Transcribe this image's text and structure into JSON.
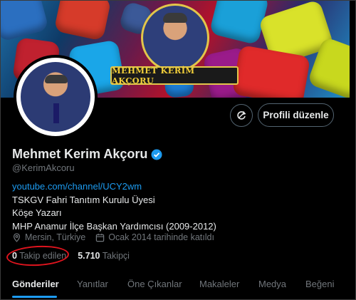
{
  "banner": {
    "overlay_name": "MEHMET KERİM AKÇORU"
  },
  "profile": {
    "display_name": "Mehmet Kerim Akçoru",
    "handle": "@KerimAkcoru",
    "verified_icon": "verified-badge-icon",
    "link": "youtube.com/channel/UCY2wm",
    "bio_lines": [
      "TSKGV Fahri Tanıtım Kurulu Üyesi",
      "Köşe Yazarı",
      "MHP Anamur İlçe Başkan Yardımcısı (2009-2012)"
    ],
    "location": "Mersin, Türkiye",
    "joined": "Ocak 2014 tarihinde katıldı"
  },
  "actions": {
    "edit_profile": "Profili düzenle",
    "refresh_icon": "refresh-icon"
  },
  "stats": {
    "following_count": "0",
    "following_label": "Takip edilen",
    "followers_count": "5.710",
    "followers_label": "Takipçi"
  },
  "tabs": [
    {
      "label": "Gönderiler",
      "active": true
    },
    {
      "label": "Yanıtlar",
      "active": false
    },
    {
      "label": "Öne Çıkanlar",
      "active": false
    },
    {
      "label": "Makaleler",
      "active": false
    },
    {
      "label": "Medya",
      "active": false
    },
    {
      "label": "Beğeni",
      "active": false
    }
  ],
  "colors": {
    "accent": "#1d9bf0",
    "annotation_circle": "#e0141e",
    "banner_frame": "#e2c64a"
  }
}
